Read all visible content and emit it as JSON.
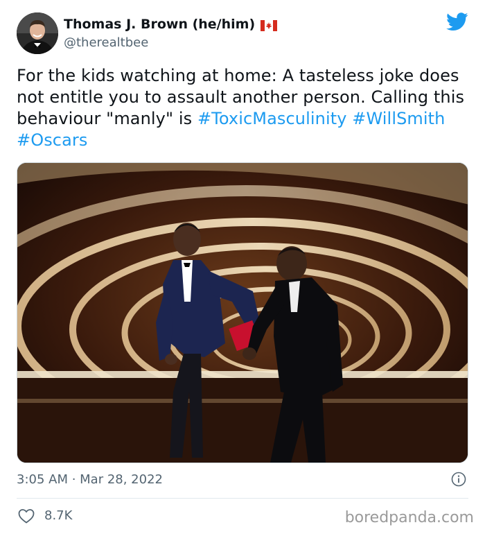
{
  "author": {
    "display_name": "Thomas J. Brown (he/him)",
    "flag_icon": "canada-flag-icon",
    "handle": "@therealtbee",
    "avatar_icon": "profile-photo-avatar"
  },
  "brand": {
    "icon": "twitter-bird-icon",
    "color": "#1d9bf0"
  },
  "tweet": {
    "text_parts": [
      "For the kids watching at home: A tasteless joke does not entitle you to assault another person. Calling this behaviour \"manly\" is "
    ],
    "hashtags": [
      "#ToxicMasculinity",
      "#WillSmith",
      "#Oscars"
    ]
  },
  "media": {
    "icon": "photo-stage-scene"
  },
  "meta": {
    "timestamp": "3:05 AM · Mar 28, 2022",
    "info_icon": "info-icon"
  },
  "engagement": {
    "like_icon": "heart-icon",
    "likes": "8.7K"
  },
  "watermark": "boredpanda.com",
  "colors": {
    "text": "#0f1419",
    "secondary": "#536471",
    "link": "#1d9bf0"
  }
}
